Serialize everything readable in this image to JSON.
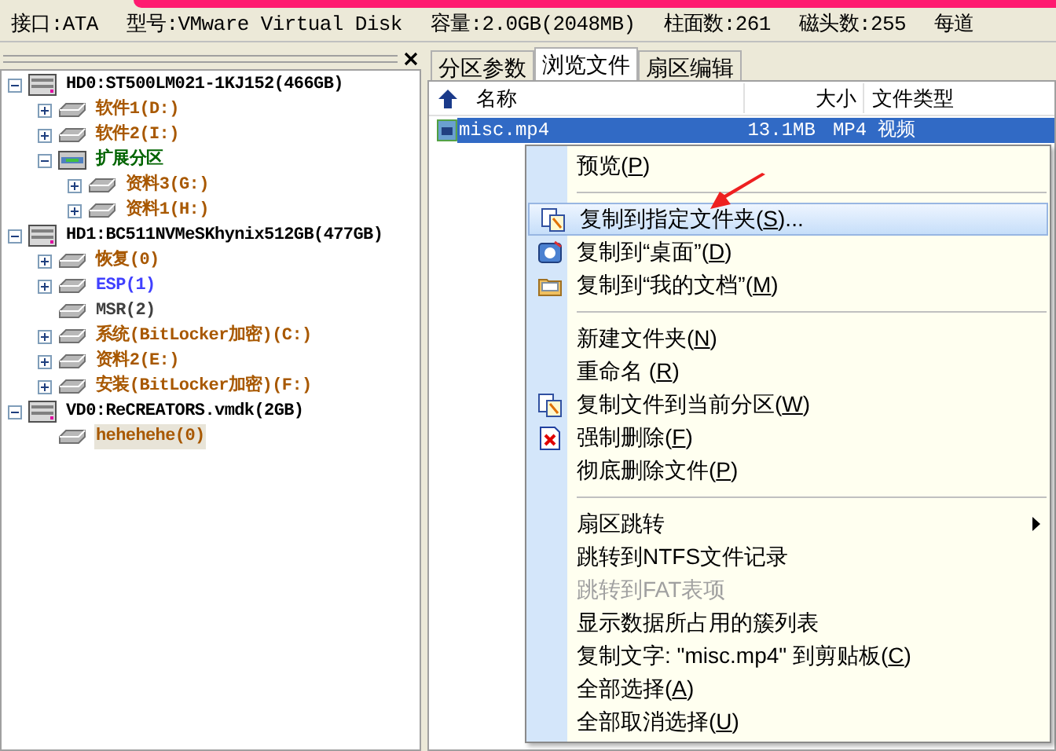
{
  "info_bar": [
    "接口:ATA",
    "型号:VMware Virtual Disk",
    "容量:2.0GB(2048MB)",
    "柱面数:261",
    "磁头数:255",
    "每道"
  ],
  "tree": [
    {
      "label": "HD0:ST500LM021-1KJ152(466GB)",
      "kind": "disk",
      "color": "#000000",
      "expanded": true,
      "selected": false,
      "children": [
        {
          "label": "软件1(D:)",
          "kind": "partition",
          "color": "#a85800",
          "expanded": false,
          "selected": false
        },
        {
          "label": "软件2(I:)",
          "kind": "partition",
          "color": "#a85800",
          "expanded": false,
          "selected": false
        },
        {
          "label": "扩展分区",
          "kind": "extended",
          "color": "#006400",
          "expanded": true,
          "selected": false,
          "children": [
            {
              "label": "资料3(G:)",
              "kind": "partition",
              "color": "#a85800",
              "expanded": false,
              "selected": false
            },
            {
              "label": "资料1(H:)",
              "kind": "partition",
              "color": "#a85800",
              "expanded": false,
              "selected": false
            }
          ]
        }
      ]
    },
    {
      "label": "HD1:BC511NVMeSKhynix512GB(477GB)",
      "kind": "disk",
      "color": "#000000",
      "expanded": true,
      "selected": false,
      "children": [
        {
          "label": "恢复(0)",
          "kind": "partition",
          "color": "#a85800",
          "expanded": false,
          "selected": false
        },
        {
          "label": "ESP(1)",
          "kind": "partition",
          "color": "#4040ff",
          "expanded": false,
          "selected": false
        },
        {
          "label": "MSR(2)",
          "kind": "partition",
          "color": "#404040",
          "selected": false
        },
        {
          "label": "系统(BitLocker加密)(C:)",
          "kind": "partition",
          "color": "#a85800",
          "expanded": false,
          "selected": false
        },
        {
          "label": "资料2(E:)",
          "kind": "partition",
          "color": "#a85800",
          "expanded": false,
          "selected": false
        },
        {
          "label": "安装(BitLocker加密)(F:)",
          "kind": "partition",
          "color": "#a85800",
          "expanded": false,
          "selected": false
        }
      ]
    },
    {
      "label": "VD0:ReCREATORS.vmdk(2GB)",
      "kind": "disk",
      "color": "#000000",
      "expanded": true,
      "selected": false,
      "children": [
        {
          "label": "hehehehe(0)",
          "kind": "partition",
          "color": "#a85800",
          "selected": true
        }
      ]
    }
  ],
  "tabs": [
    {
      "label": "分区参数",
      "selected": false
    },
    {
      "label": "浏览文件",
      "selected": true
    },
    {
      "label": "扇区编辑",
      "selected": false
    }
  ],
  "columns": [
    "名称",
    "大小",
    "文件类型"
  ],
  "files": [
    {
      "name": "misc.mp4",
      "size": "13.1MB",
      "type": "MP4 视频",
      "selected": true
    }
  ],
  "context_menu": [
    {
      "kind": "item",
      "label": "预览(P)",
      "disabled": false,
      "highlighted": false
    },
    {
      "kind": "separator"
    },
    {
      "kind": "item",
      "label": "复制到指定文件夹(S)...",
      "disabled": false,
      "highlighted": true
    },
    {
      "kind": "item",
      "label": "复制到“桌面”(D)",
      "disabled": false,
      "highlighted": false
    },
    {
      "kind": "item",
      "label": "复制到“我的文档”(M)",
      "disabled": false,
      "highlighted": false
    },
    {
      "kind": "separator"
    },
    {
      "kind": "item",
      "label": "新建文件夹(N)",
      "disabled": false,
      "highlighted": false
    },
    {
      "kind": "item",
      "label": "重命名 (R)",
      "disabled": false,
      "highlighted": false
    },
    {
      "kind": "item",
      "label": "复制文件到当前分区(W)",
      "disabled": false,
      "highlighted": false
    },
    {
      "kind": "item",
      "label": "强制删除(F)",
      "disabled": false,
      "highlighted": false
    },
    {
      "kind": "item",
      "label": "彻底删除文件(P)",
      "disabled": false,
      "highlighted": false
    },
    {
      "kind": "separator"
    },
    {
      "kind": "item",
      "label": "扇区跳转",
      "disabled": false,
      "highlighted": false,
      "submenu": true
    },
    {
      "kind": "item",
      "label": "跳转到NTFS文件记录",
      "disabled": false,
      "highlighted": false
    },
    {
      "kind": "item",
      "label": "跳转到FAT表项",
      "disabled": true,
      "highlighted": false
    },
    {
      "kind": "item",
      "label": "显示数据所占用的簇列表",
      "disabled": false,
      "highlighted": false
    },
    {
      "kind": "item",
      "label": "复制文字: \"misc.mp4\" 到剪贴板(C)",
      "disabled": false,
      "highlighted": false
    },
    {
      "kind": "item",
      "label": "全部选择(A)",
      "disabled": false,
      "highlighted": false
    },
    {
      "kind": "item",
      "label": "全部取消选择(U)",
      "disabled": false,
      "highlighted": false
    }
  ]
}
